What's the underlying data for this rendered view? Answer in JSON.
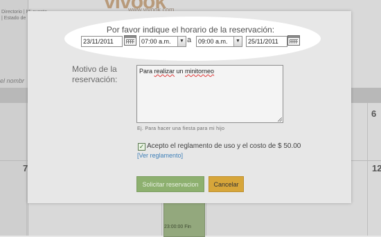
{
  "background": {
    "logo": "vivook",
    "logo_url": "www.vivook.com",
    "top_left_lines": [
      "Directorio | Mi cuenta",
      "| Estado de"
    ],
    "nombre_fragment": "el nombr",
    "days": [
      "7",
      "6",
      "12"
    ],
    "event_label": "23:00:00 Fin"
  },
  "modal": {
    "schedule_title": "Por favor indique el horario de la reservación:",
    "start_date": "23/11/2011",
    "start_time": "07:00 a.m.",
    "separator": "a",
    "end_time": "09:00 a.m.",
    "end_date": "25/11/2011",
    "motivo_label": "Motivo de la reservación:",
    "motivo_prefix": "Para ",
    "motivo_misspelled_1": "realizar",
    "motivo_space": " un ",
    "motivo_misspelled_2": "minitorneo",
    "hint": "Ej. Para hacer una fiesta para mi hijo",
    "accept_text": "Acepto el reglamento de uso y el costo de $ 50.00",
    "accept_checked": true,
    "rules_link": "[Ver reglamento]",
    "submit_label": "Solicitar reservacion",
    "cancel_label": "Cancelar"
  },
  "icons": {
    "calendar": "calendar-icon",
    "dropdown": "chevron-down-icon",
    "check": "✓"
  },
  "colors": {
    "submit_bg": "#8db06f",
    "cancel_bg": "#d7a63a",
    "link": "#3e7fb8"
  }
}
